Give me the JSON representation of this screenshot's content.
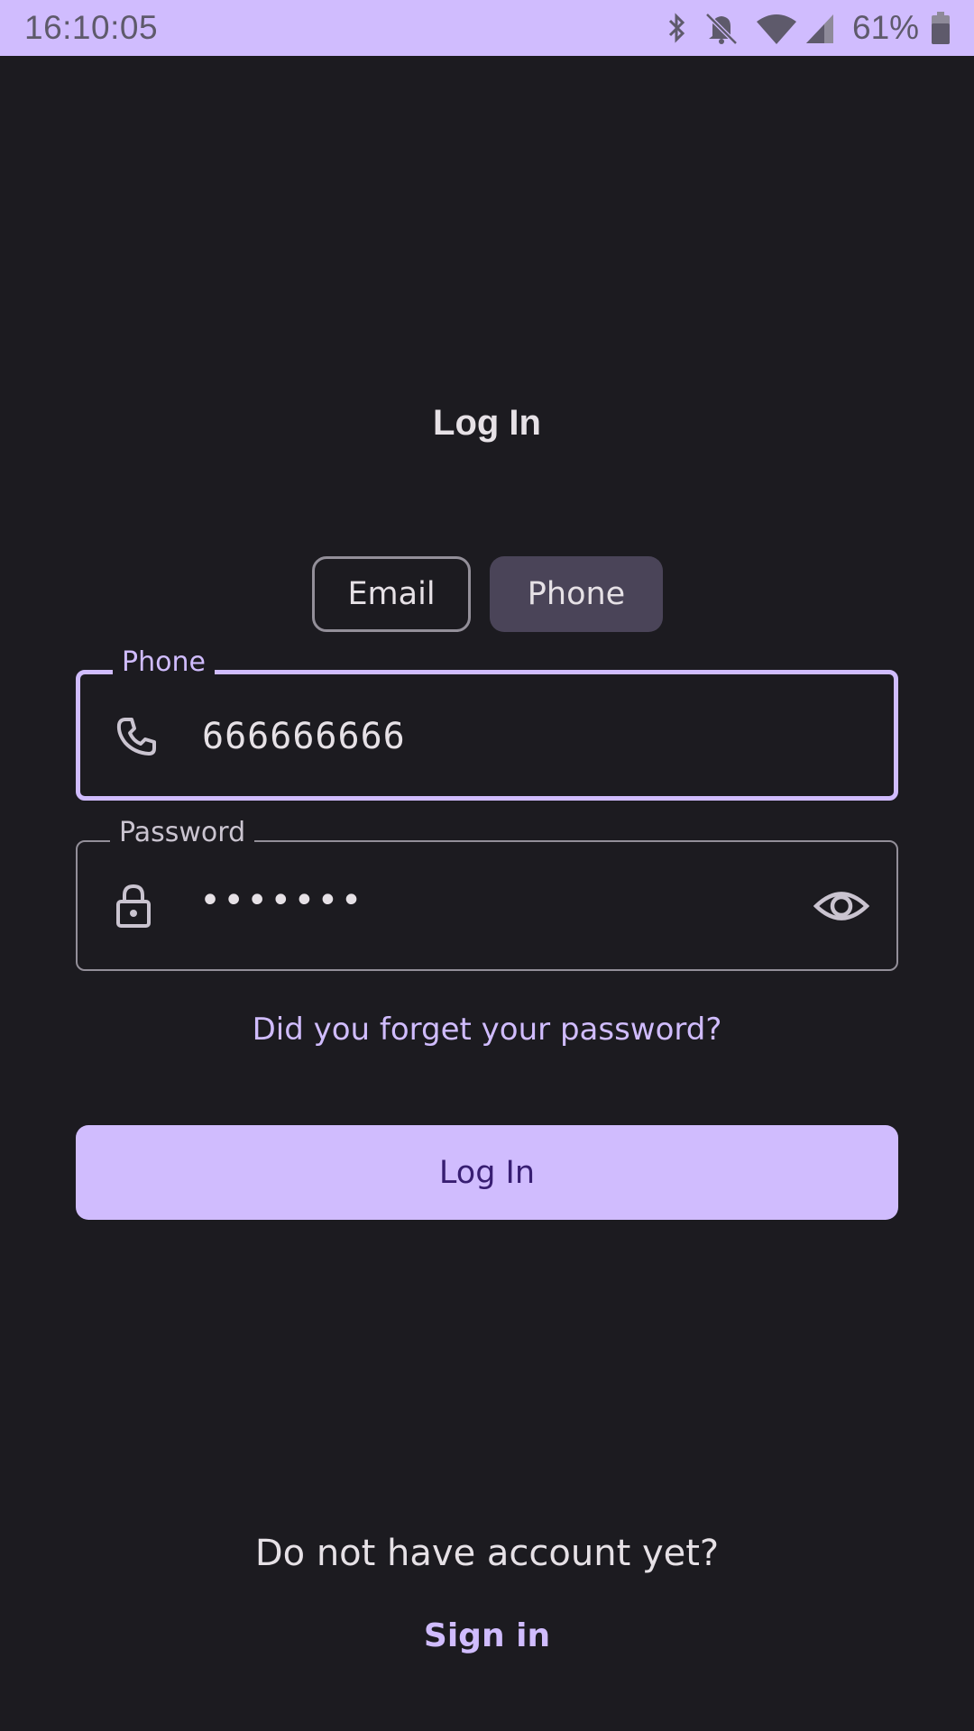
{
  "status_bar": {
    "time": "16:10:05",
    "battery_percent": "61%",
    "icons": [
      "bluetooth-icon",
      "notifications-off-icon",
      "wifi-icon",
      "cell-signal-icon",
      "battery-icon"
    ]
  },
  "screen": {
    "title": "Log In",
    "login_method_tabs": [
      {
        "label": "Email",
        "selected": false
      },
      {
        "label": "Phone",
        "selected": true
      }
    ]
  },
  "form": {
    "phone": {
      "label": "Phone",
      "value": "666666666",
      "icon": "phone-icon"
    },
    "password": {
      "label": "Password",
      "value": "•••••••",
      "icon": "lock-icon",
      "toggle_icon": "eye-icon"
    },
    "forgot_link": "Did you forget your password?",
    "submit_label": "Log In"
  },
  "footer": {
    "prompt": "Do not have account yet?",
    "signin_link": "Sign in"
  },
  "colors": {
    "background": "#1c1b20",
    "accent": "#d0bcfe",
    "on_accent": "#381e72",
    "selected_tab": "#4a4458",
    "outline": "#938f99"
  }
}
